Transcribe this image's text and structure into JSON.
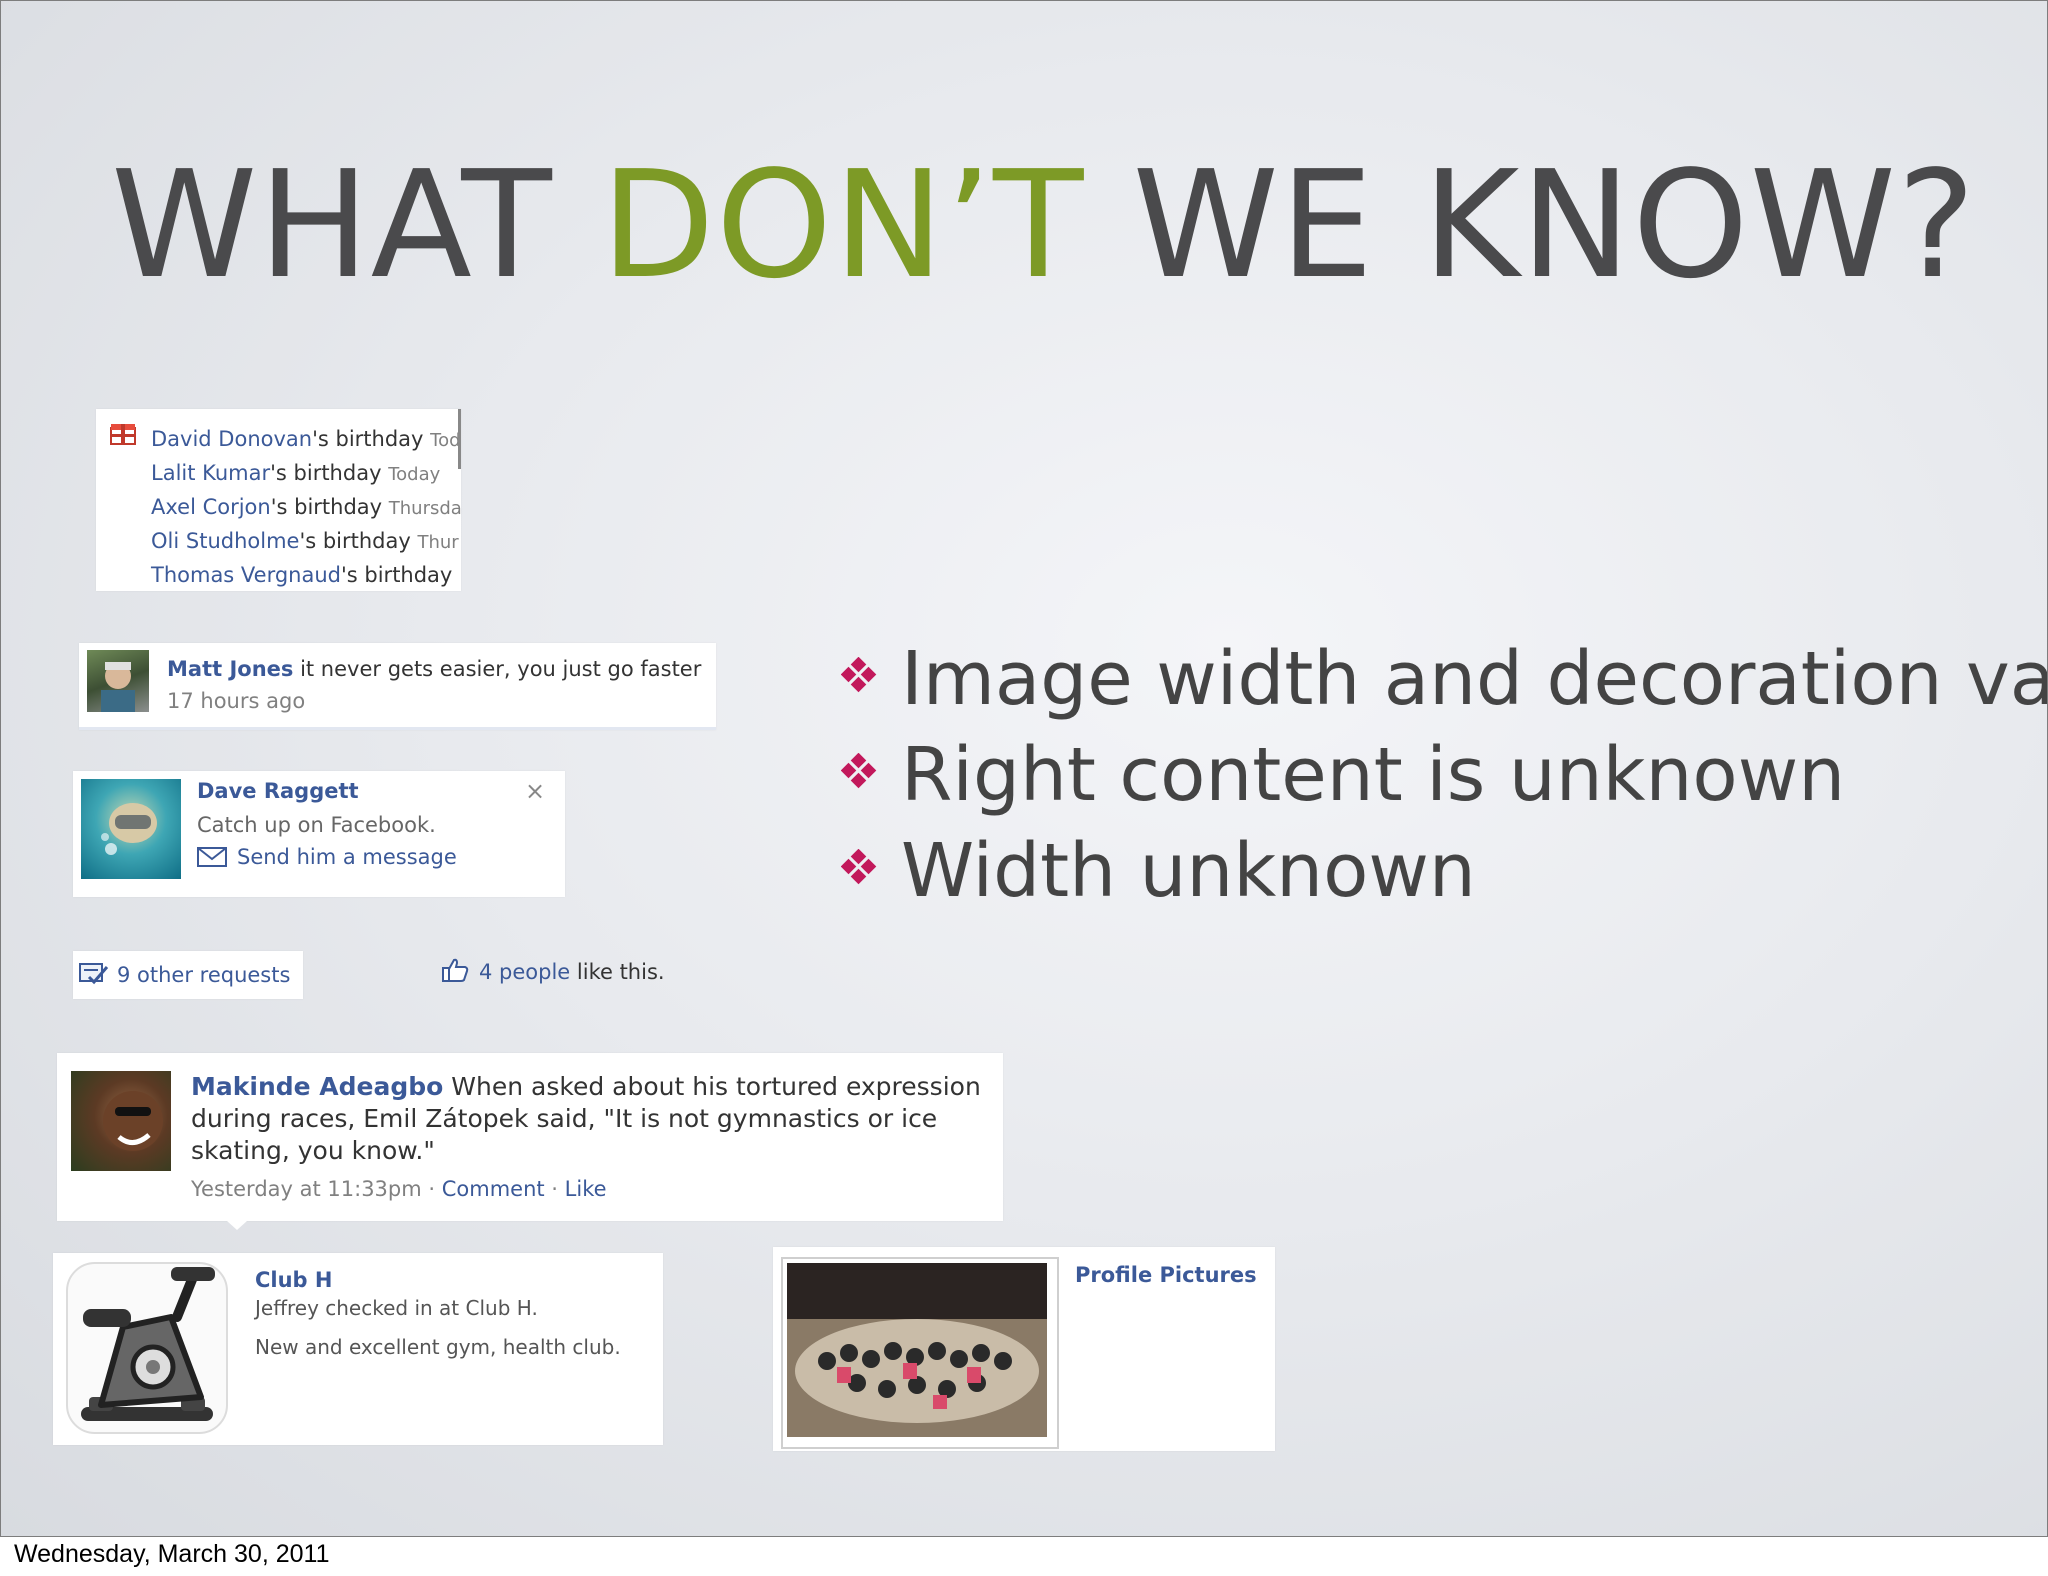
{
  "slide": {
    "title": {
      "part1": "WHAT ",
      "accent": "DON’T",
      "part2": " WE KNOW?"
    },
    "bullets": [
      "Image width and decoration vary",
      "Right content is unknown",
      "Width unknown"
    ]
  },
  "birthdays": [
    {
      "name": "David Donovan",
      "suffix": "'s birthday",
      "when": "Tod"
    },
    {
      "name": "Lalit Kumar",
      "suffix": "'s birthday",
      "when": "Today"
    },
    {
      "name": "Axel Corjon",
      "suffix": "'s birthday",
      "when": "Thursda"
    },
    {
      "name": "Oli Studholme",
      "suffix": "'s birthday",
      "when": "Thur"
    },
    {
      "name": "Thomas Vergnaud",
      "suffix": "'s birthday",
      "when": ""
    }
  ],
  "matt": {
    "name": "Matt Jones",
    "status": " it never gets easier, you just go faster",
    "time": "17 hours ago"
  },
  "dave": {
    "name": "Dave Raggett",
    "sub": "Catch up on Facebook.",
    "action": "Send him a message",
    "close": "×"
  },
  "requests": {
    "label": "9 other requests"
  },
  "likes": {
    "count": "4 people",
    "suffix": " like this."
  },
  "makinde": {
    "name": "Makinde Adeagbo",
    "text": " When asked about his tortured expression during races, Emil Zátopek said, \"It is not gymnastics or ice skating, you know.\"",
    "time": "Yesterday at 11:33pm",
    "sep1": " · ",
    "comment": "Comment",
    "sep2": " · ",
    "like": "Like"
  },
  "club": {
    "name": "Club H",
    "line1": "Jeffrey checked in at Club H.",
    "line2": "New and excellent gym, health club."
  },
  "profile": {
    "caption": "Profile Pictures"
  },
  "footer": {
    "date": "Wednesday, March 30, 2011"
  },
  "colors": {
    "title": "#4a4a4c",
    "accent": "#7d9a26",
    "link": "#3b5998",
    "bullet": "#c2185b"
  }
}
